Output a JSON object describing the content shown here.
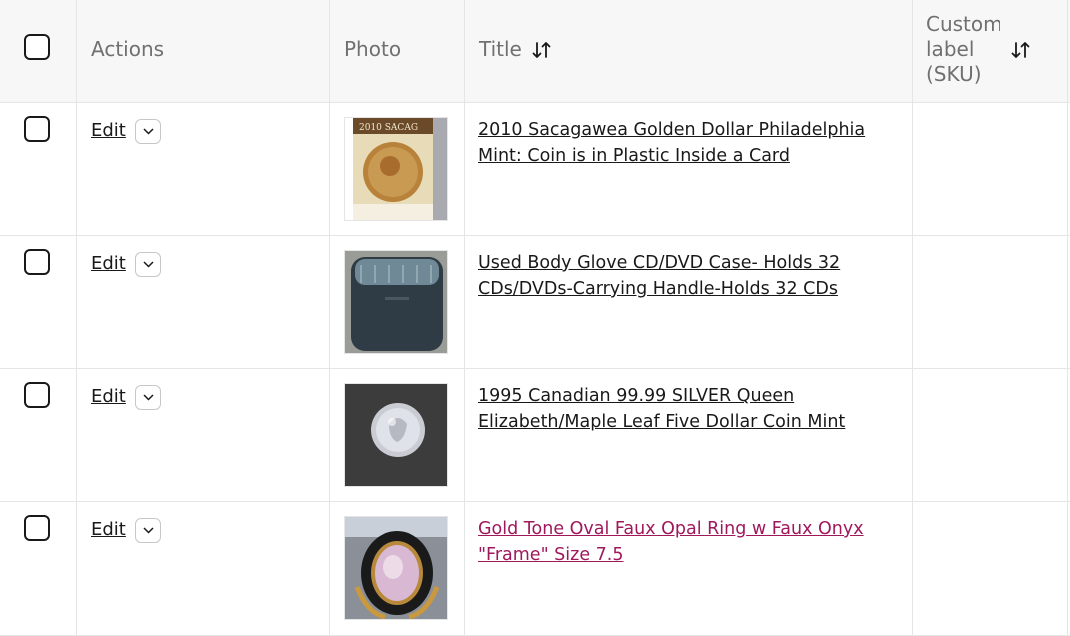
{
  "header": {
    "actions": "Actions",
    "photo": "Photo",
    "title": "Title",
    "sku": "Custom\nlabel\n(SKU)"
  },
  "rows": [
    {
      "edit": "Edit",
      "title": "2010 Sacagawea Golden Dollar Philadelphia Mint: Coin is in Plastic Inside a Card",
      "photo_icon": "coin-card-photo",
      "sku": ""
    },
    {
      "edit": "Edit",
      "title": "Used Body Glove CD/DVD Case- Holds 32 CDs/DVDs-Carrying Handle-Holds 32 CDs",
      "photo_icon": "cd-case-photo",
      "sku": ""
    },
    {
      "edit": "Edit",
      "title": "1995 Canadian 99.99 SILVER Queen Elizabeth/Maple Leaf Five Dollar Coin Mint",
      "photo_icon": "silver-coin-photo",
      "sku": ""
    },
    {
      "edit": "Edit",
      "title": "Gold Tone Oval Faux Opal Ring w Faux Onyx \"Frame\" Size 7.5",
      "photo_icon": "ring-photo",
      "sku": "",
      "title_color": "#a0185c"
    }
  ]
}
